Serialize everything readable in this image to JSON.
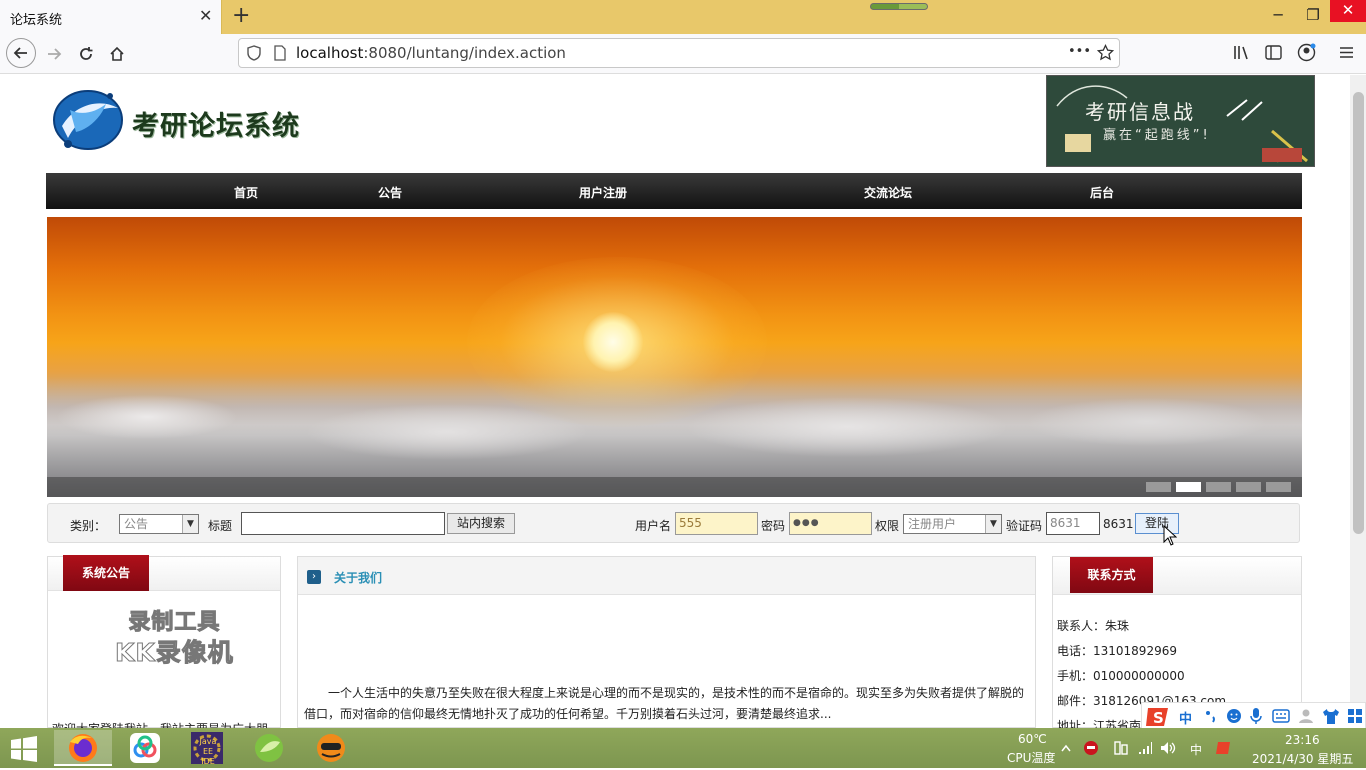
{
  "browser": {
    "tab_title": "论坛系统",
    "tab_close": "✕",
    "new_tab": "+",
    "url_host": "localhost",
    "url_rest": ":8080/luntang/index.action",
    "url_more": "•••",
    "win_min": "─",
    "win_max": "❐",
    "win_close": "✕"
  },
  "site": {
    "title": "考研论坛系统",
    "banner_right_title": "考研信息战",
    "banner_right_sub": "赢在“起跑线”!"
  },
  "mainnav": [
    "首页",
    "公告",
    "用户注册",
    "交流论坛",
    "后台"
  ],
  "slider": {
    "active_index": 1,
    "dot_count": 5
  },
  "search": {
    "category_label": "类别：",
    "category_value": "公告",
    "title_label": "标题",
    "title_value": "",
    "search_button": "站内搜索"
  },
  "login": {
    "username_label": "用户名",
    "username_value": "555",
    "password_label": "密码",
    "password_value": "●●●",
    "role_label": "权限",
    "role_value": "注册用户",
    "captcha_label": "验证码",
    "captcha_value": "8631",
    "captcha_code": "8631",
    "login_button": "登陆"
  },
  "notice_panel": {
    "title": "系统公告",
    "watermark_line1": "录制工具",
    "watermark_line2": "KK录像机",
    "body": "欢迎大家登陆我站，我站主要是为广大朋"
  },
  "about_panel": {
    "title": "关于我们",
    "icon": "›",
    "body": "一个人生活中的失意乃至失败在很大程度上来说是心理的而不是现实的，是技术性的而不是宿命的。现实至多为失败者提供了解脱的借口，而对宿命的信仰最终无情地扑灭了成功的任何希望。千万别摸着石头过河，要清楚最终追求..."
  },
  "contact_panel": {
    "title": "联系方式",
    "lines": [
      "联系人：朱珠",
      "电话：13101892969",
      "手机：010000000000",
      "邮件：318126091@163.com",
      "地址：江苏省南京"
    ]
  },
  "taskbar": {
    "temp": "60℃",
    "temp_label": "CPU温度",
    "ime": "中",
    "time": "23:16",
    "date": "2021/4/30 星期五",
    "ide_label": "Java EE IDE"
  },
  "colors": {
    "tabbar": "#e8c86a",
    "nav_dark": "#111111",
    "accent_red": "#a00d15",
    "link_blue": "#2a8fb5",
    "taskbar": "#8fa75a"
  }
}
